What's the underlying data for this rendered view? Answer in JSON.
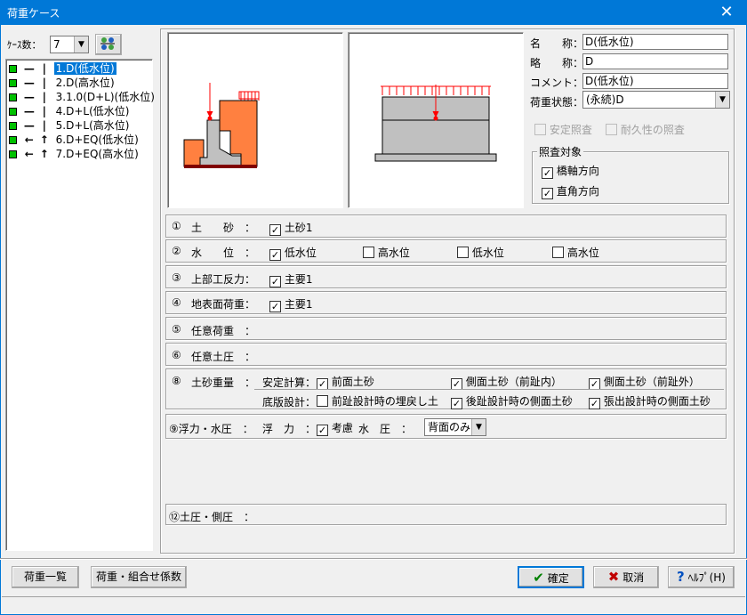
{
  "window": {
    "title": "荷重ケース",
    "close_glyph": "✕"
  },
  "case_count": {
    "label": "ｹｰｽ数：",
    "value": "7"
  },
  "cases": [
    {
      "dir1": "—",
      "dir2": "|",
      "label": "1.D(低水位)"
    },
    {
      "dir1": "—",
      "dir2": "|",
      "label": "2.D(高水位)"
    },
    {
      "dir1": "—",
      "dir2": "|",
      "label": "3.1.0(D+L)(低水位)"
    },
    {
      "dir1": "—",
      "dir2": "|",
      "label": "4.D+L(低水位)"
    },
    {
      "dir1": "—",
      "dir2": "|",
      "label": "5.D+L(高水位)"
    },
    {
      "dir1": "←",
      "dir2": "↑",
      "label": "6.D+EQ(低水位)"
    },
    {
      "dir1": "←",
      "dir2": "↑",
      "label": "7.D+EQ(高水位)"
    }
  ],
  "props": {
    "name_label": "名　　称：",
    "name_value": "D(低水位)",
    "abbr_label": "略　　称：",
    "abbr_value": "D",
    "comment_label": "コメント：",
    "comment_value": "D(低水位)",
    "state_label": "荷重状態：",
    "state_value": "(永続)D"
  },
  "checks": {
    "stability": "安定照査",
    "durability": "耐久性の照査"
  },
  "target": {
    "title": "照査対象",
    "bridge_axis": "橋軸方向",
    "perpendicular": "直角方向"
  },
  "rows": {
    "r1": {
      "num": "①",
      "label": "土　　砂　：",
      "items": [
        "土砂1"
      ]
    },
    "r2": {
      "num": "②",
      "label": "水　　位　：",
      "items": [
        "低水位",
        "高水位",
        "低水位",
        "高水位"
      ]
    },
    "r3": {
      "num": "③",
      "label": "上部工反力：",
      "items": [
        "主要1"
      ]
    },
    "r4": {
      "num": "④",
      "label": "地表面荷重：",
      "items": [
        "主要1"
      ]
    },
    "r5": {
      "num": "⑤",
      "label": "任意荷重　："
    },
    "r6": {
      "num": "⑥",
      "label": "任意土圧　："
    },
    "r8": {
      "num": "⑧",
      "label": "土砂重量　：",
      "stab_label": "安定計算：",
      "stab_items": [
        "前面土砂",
        "側面土砂（前趾内）",
        "側面土砂（前趾外）"
      ],
      "slab_label": "底版設計：",
      "slab_items": [
        "前趾設計時の埋戻し土",
        "後趾設計時の側面土砂",
        "張出設計時の側面土砂"
      ]
    },
    "r9": {
      "label": "⑨浮力・水圧　：",
      "buoy_label": "浮　力　：",
      "buoy_item": "考慮",
      "wp_label": "水　圧　：",
      "wp_value": "背面のみ"
    },
    "r12": {
      "label": "⑫土圧・側圧　："
    }
  },
  "buttons": {
    "load_list": "荷重一覧",
    "combo_coef": "荷重・組合せ係数",
    "ok": "確定",
    "cancel": "取消",
    "help": "ﾍﾙﾌﾟ(H)"
  },
  "colors": {
    "accent": "#0078d7",
    "soil": "#ff8040",
    "concrete": "#c0c0c0",
    "load": "#ff0000"
  }
}
